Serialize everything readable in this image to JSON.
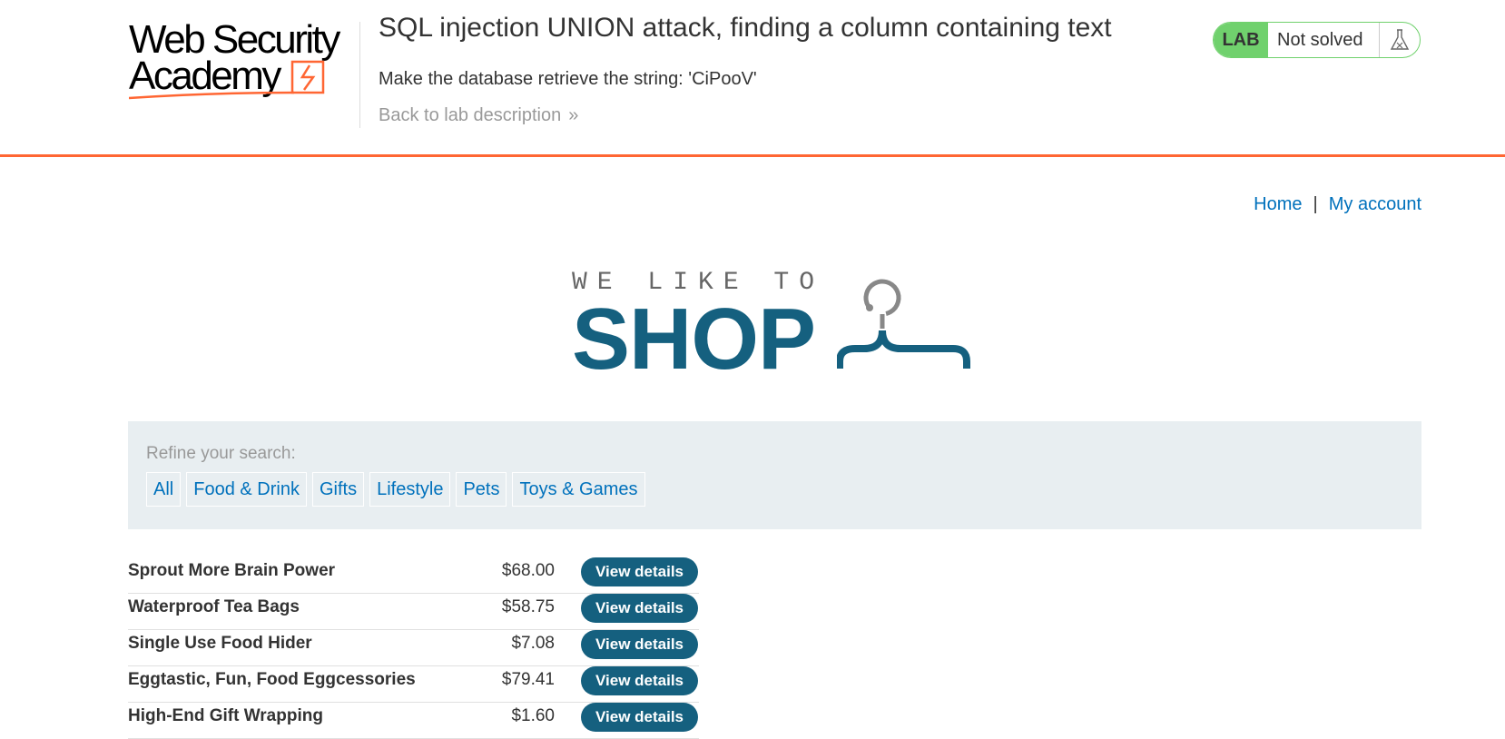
{
  "academy": {
    "logo_line1": "Web Security",
    "logo_line2": "Academy",
    "lab_title": "SQL injection UNION attack, finding a column containing text",
    "objective": "Make the database retrieve the string: 'CiPooV'",
    "back_link": "Back to lab description",
    "badge": "LAB",
    "status": "Not solved",
    "colors": {
      "accent": "#ff6633",
      "solved_green": "#70d16d",
      "link": "#0071bc",
      "brand_blue": "#15607f"
    }
  },
  "nav": {
    "home": "Home",
    "separator": "|",
    "account": "My account"
  },
  "shop_logo": {
    "tagline": "WE LIKE TO",
    "word": "SHOP"
  },
  "filters": {
    "label": "Refine your search:",
    "items": [
      "All",
      "Food & Drink",
      "Gifts",
      "Lifestyle",
      "Pets",
      "Toys & Games"
    ]
  },
  "products": [
    {
      "name": "Sprout More Brain Power",
      "price": "$68.00",
      "button": "View details"
    },
    {
      "name": "Waterproof Tea Bags",
      "price": "$58.75",
      "button": "View details"
    },
    {
      "name": "Single Use Food Hider",
      "price": "$7.08",
      "button": "View details"
    },
    {
      "name": "Eggtastic, Fun, Food Eggcessories",
      "price": "$79.41",
      "button": "View details"
    },
    {
      "name": "High-End Gift Wrapping",
      "price": "$1.60",
      "button": "View details"
    }
  ]
}
